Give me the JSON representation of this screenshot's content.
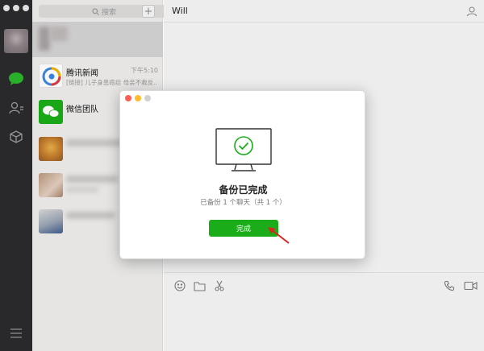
{
  "window": {
    "contact_name": "Will"
  },
  "search": {
    "placeholder": "搜索"
  },
  "chats": [
    {
      "name": "腾讯新闻",
      "time": "下午5:10",
      "preview": "[链接] 儿子身患癌症 母亲不救反..."
    },
    {
      "name": "微信团队",
      "time": "",
      "preview": ""
    }
  ],
  "modal": {
    "title": "备份已完成",
    "subtitle": "已备份 1 个聊天（共 1 个）",
    "button_label": "完成"
  },
  "colors": {
    "accent_green": "#1aad19",
    "rail_background": "#2b2b2d",
    "list_background": "#eeedec"
  },
  "icons": {
    "rail": [
      "chat-icon",
      "contacts-icon",
      "favorites-cube-icon",
      "menu-icon"
    ],
    "composer": [
      "emoji-icon",
      "folder-icon",
      "scissors-icon",
      "phone-icon",
      "video-icon"
    ],
    "header": [
      "profile-icon"
    ],
    "modal": [
      "monitor-check-icon"
    ]
  }
}
